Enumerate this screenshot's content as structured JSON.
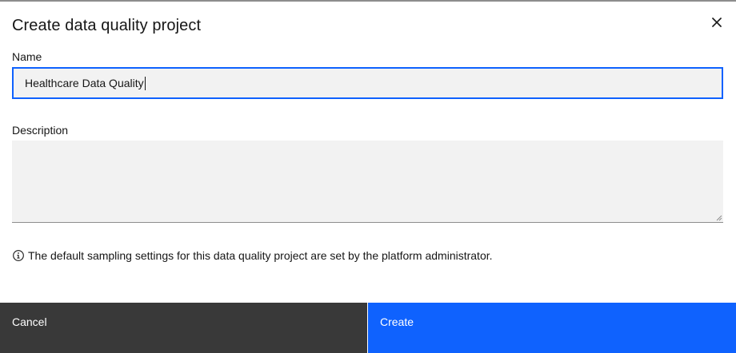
{
  "modal": {
    "title": "Create data quality project",
    "close_icon": "close-icon"
  },
  "form": {
    "name_label": "Name",
    "name_value": "Healthcare Data Quality",
    "description_label": "Description",
    "description_value": ""
  },
  "info": {
    "icon": "info-icon",
    "text": "The default sampling settings for this data quality project are set by the platform administrator."
  },
  "footer": {
    "cancel_label": "Cancel",
    "create_label": "Create"
  },
  "colors": {
    "primary": "#0f62fe",
    "secondary": "#393939",
    "field_bg": "#f2f2f2"
  }
}
